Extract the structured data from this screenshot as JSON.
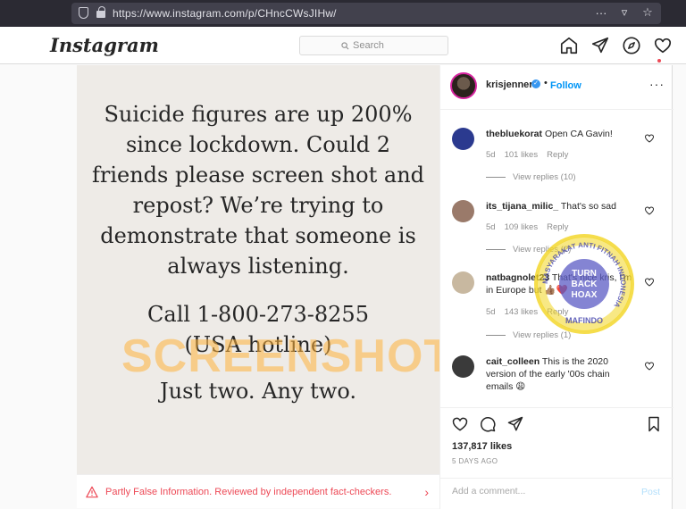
{
  "browser": {
    "url": "https://www.instagram.com/p/CHncCWsJIHw/",
    "actions": [
      "···",
      "▿",
      "☆"
    ]
  },
  "header": {
    "logo": "Instagram",
    "search_placeholder": "Search"
  },
  "post": {
    "lines_1": [
      "Suicide figures are up 200%",
      "since lockdown. Could 2",
      "friends please screen shot and",
      "repost? We’re trying to",
      "demonstrate that someone is",
      "always listening."
    ],
    "lines_2": [
      "Call 1-800-273-8255",
      "(USA hotline)"
    ],
    "lines_3": [
      "Just two. Any two."
    ],
    "watermark": "SCREENSHOT BY",
    "fact_check": "Partly False Information. Reviewed by independent fact-checkers.",
    "fact_chevron": "›"
  },
  "panel": {
    "username": "krisjenner",
    "verified_mark": "✓",
    "separator": "•",
    "follow": "Follow",
    "more": "···"
  },
  "comments": [
    {
      "user": "thebluekorat",
      "text": "Open CA Gavin!",
      "age": "5d",
      "likes": "101 likes",
      "reply": "Reply",
      "view_replies": "View replies (10)",
      "avatar_color": "#2b3a8f"
    },
    {
      "user": "its_tijana_milic_",
      "text": "That's so sad",
      "age": "5d",
      "likes": "109 likes",
      "reply": "Reply",
      "view_replies": "View replies (2)",
      "avatar_color": "#9a7a6a"
    },
    {
      "user": "natbagnolet23",
      "text": "That's nice kris, I'm in Europe but 👍🏽❤️",
      "age": "5d",
      "likes": "143 likes",
      "reply": "Reply",
      "view_replies": "View replies (1)",
      "avatar_color": "#c8b8a0"
    },
    {
      "user": "cait_colleen",
      "text": "This is the 2020 version of the early '00s chain emails 😩",
      "avatar_color": "#3a3a3a"
    }
  ],
  "footer": {
    "likes": "137,817 likes",
    "date": "5 DAYS AGO",
    "comment_placeholder": "Add a comment...",
    "post": "Post"
  },
  "stamp": {
    "ring_text": "MASYARAKAT ANTI FITNAH INDONESIA",
    "center": [
      "TURN",
      "BACK",
      "HOAX"
    ],
    "org": "MAFINDO",
    "color": "#f2d51f"
  },
  "colors": {
    "accent": "#0095f6",
    "warning": "#ed4956"
  }
}
